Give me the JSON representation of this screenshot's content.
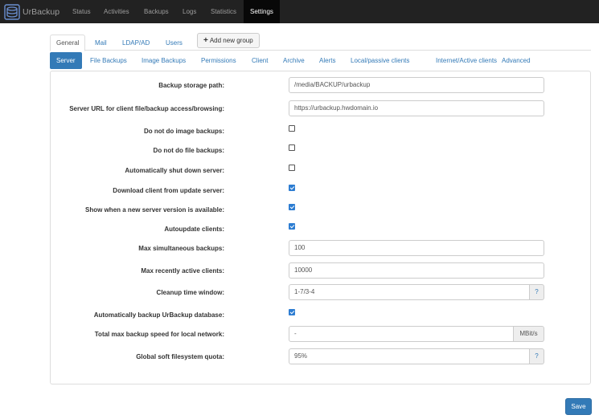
{
  "app": {
    "brand": "UrBackup",
    "logo_icon": "urbackup-logo-icon",
    "nav": [
      {
        "label": "Status"
      },
      {
        "label": "Activities"
      },
      {
        "label": "Backups"
      },
      {
        "label": "Logs"
      },
      {
        "label": "Statistics"
      },
      {
        "label": "Settings",
        "active": true
      }
    ]
  },
  "settings_tabs": [
    {
      "label": "General",
      "active": true
    },
    {
      "label": "Mail"
    },
    {
      "label": "LDAP/AD"
    },
    {
      "label": "Users"
    }
  ],
  "add_group_button": {
    "icon": "plus-icon",
    "label": "Add new group"
  },
  "sub_tabs": [
    {
      "label": "Server",
      "active": true
    },
    {
      "label": "File Backups"
    },
    {
      "label": "Image Backups"
    },
    {
      "label": "Permissions"
    },
    {
      "label": "Client"
    },
    {
      "label": "Archive"
    },
    {
      "label": "Alerts"
    },
    {
      "label": "Local/passive clients"
    },
    {
      "label": "Internet/Active clients"
    },
    {
      "label": "Advanced"
    }
  ],
  "form": {
    "backup_storage_path": {
      "label": "Backup storage path:",
      "value": "/media/BACKUP/urbackup"
    },
    "server_url": {
      "label": "Server URL for client file/backup access/browsing:",
      "value": "https://urbackup.hwdomain.io"
    },
    "no_image_backups": {
      "label": "Do not do image backups:",
      "checked": false
    },
    "no_file_backups": {
      "label": "Do not do file backups:",
      "checked": false
    },
    "auto_shutdown": {
      "label": "Automatically shut down server:",
      "checked": false
    },
    "download_client": {
      "label": "Download client from update server:",
      "checked": true
    },
    "show_new_version": {
      "label": "Show when a new server version is available:",
      "checked": true
    },
    "autoupdate_clients": {
      "label": "Autoupdate clients:",
      "checked": true
    },
    "max_simultaneous": {
      "label": "Max simultaneous backups:",
      "value": "100"
    },
    "max_recently_active": {
      "label": "Max recently active clients:",
      "value": "10000"
    },
    "cleanup_window": {
      "label": "Cleanup time window:",
      "value": "1-7/3-4",
      "help": "?"
    },
    "auto_backup_db": {
      "label": "Automatically backup UrBackup database:",
      "checked": true
    },
    "total_max_speed": {
      "label": "Total max backup speed for local network:",
      "value": "-",
      "unit": "MBit/s"
    },
    "global_quota": {
      "label": "Global soft filesystem quota:",
      "value": "95%",
      "help": "?"
    }
  },
  "save_button": {
    "label": "Save"
  },
  "colors": {
    "navbar": "#222222",
    "accent": "#337ab7",
    "checkbox": "#2d7dd2"
  }
}
